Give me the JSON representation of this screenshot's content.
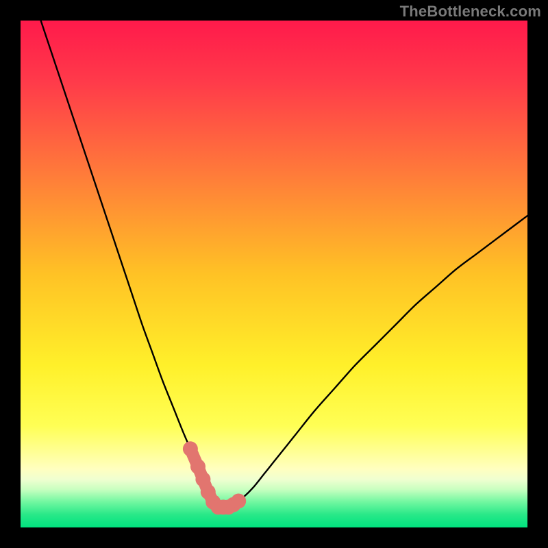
{
  "watermark": "TheBottleneck.com",
  "colors": {
    "frame": "#000000",
    "gradient_stops": [
      {
        "offset": 0.0,
        "color": "#ff1a4b"
      },
      {
        "offset": 0.12,
        "color": "#ff3a4a"
      },
      {
        "offset": 0.3,
        "color": "#ff7a3a"
      },
      {
        "offset": 0.5,
        "color": "#ffc225"
      },
      {
        "offset": 0.68,
        "color": "#fff02a"
      },
      {
        "offset": 0.8,
        "color": "#ffff55"
      },
      {
        "offset": 0.885,
        "color": "#ffffc0"
      },
      {
        "offset": 0.905,
        "color": "#f0ffd0"
      },
      {
        "offset": 0.925,
        "color": "#c8ffc0"
      },
      {
        "offset": 0.95,
        "color": "#70f7a0"
      },
      {
        "offset": 0.975,
        "color": "#28e888"
      },
      {
        "offset": 1.0,
        "color": "#00e37f"
      }
    ],
    "curve": "#000000",
    "marker_fill": "#e2756f",
    "marker_stroke": "#c85a56"
  },
  "chart_data": {
    "type": "line",
    "title": "",
    "xlabel": "",
    "ylabel": "",
    "xlim": [
      0,
      100
    ],
    "ylim": [
      0,
      100
    ],
    "series": [
      {
        "name": "bottleneck-curve",
        "x": [
          4,
          6,
          8,
          10,
          12,
          14,
          16,
          18,
          20,
          22,
          24,
          26,
          28,
          30,
          32,
          33.5,
          35,
          36,
          37,
          38,
          39,
          40,
          41,
          42,
          44,
          46,
          48,
          50,
          54,
          58,
          62,
          66,
          70,
          74,
          78,
          82,
          86,
          90,
          94,
          98,
          100
        ],
        "y": [
          100,
          94,
          88,
          82,
          76,
          70,
          64,
          58,
          52,
          46,
          40,
          34.5,
          29,
          24,
          19,
          15.5,
          12,
          9.5,
          7,
          5,
          4,
          4,
          4,
          4.5,
          6,
          8,
          10.5,
          13,
          18,
          23,
          27.5,
          32,
          36,
          40,
          44,
          47.5,
          51,
          54,
          57,
          60,
          61.5
        ]
      }
    ],
    "markers": {
      "name": "highlight-points",
      "x": [
        33.5,
        35,
        36,
        37,
        38,
        39,
        40,
        41,
        42,
        43
      ],
      "y": [
        15.5,
        12,
        9.5,
        7,
        5,
        4,
        4,
        4,
        4.5,
        5.2
      ]
    }
  }
}
